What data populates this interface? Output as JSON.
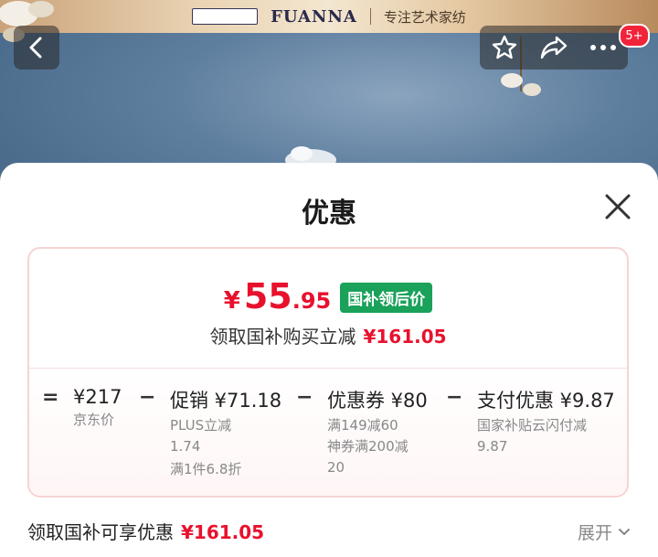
{
  "banner": {
    "brand": "FUANNA",
    "slogan": "专注艺术家纺"
  },
  "header": {
    "badge": "5+"
  },
  "sheet": {
    "title": "优惠",
    "price": {
      "currency": "¥",
      "integer": "55",
      "decimal": ".95",
      "tag": "国补领后价"
    },
    "subline": {
      "text": "领取国补购买立减",
      "amount": "¥161.05"
    },
    "breakdown": {
      "equals": "=",
      "minus": "−",
      "items": [
        {
          "main": "¥217",
          "subs": [
            "京东价"
          ]
        },
        {
          "main": "促销 ¥71.18",
          "subs": [
            "PLUS立减",
            "1.74",
            "满1件6.8折"
          ]
        },
        {
          "main": "优惠券 ¥80",
          "subs": [
            "满149减60",
            "神券满200减",
            "20"
          ]
        },
        {
          "main": "支付优惠 ¥9.87",
          "subs": [
            "国家补贴云闪付减",
            "9.87"
          ]
        }
      ]
    },
    "footer": {
      "text": "领取国补可享优惠",
      "amount": "¥161.05",
      "expand": "展开"
    }
  },
  "colors": {
    "accent_red": "#e8112d",
    "tag_green": "#1aa15a",
    "badge_red": "#f2243a"
  },
  "icons": [
    "back-icon",
    "star-icon",
    "share-icon",
    "more-icon",
    "close-icon",
    "chevron-down-icon"
  ]
}
